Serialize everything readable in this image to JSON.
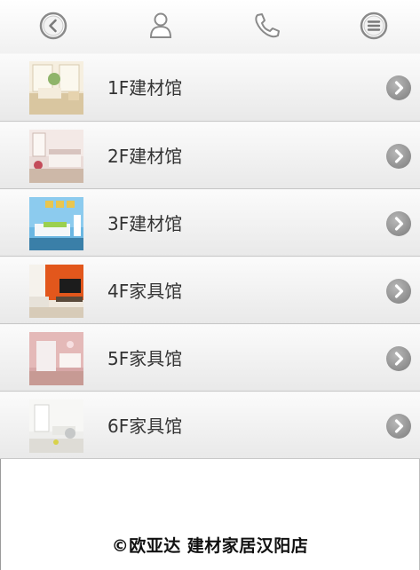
{
  "topbar": {
    "icons": [
      "back-icon",
      "user-icon",
      "phone-icon",
      "menu-icon"
    ]
  },
  "list": {
    "items": [
      {
        "label": "1F建材馆",
        "thumb": "room-photo-1"
      },
      {
        "label": "2F建材馆",
        "thumb": "room-photo-2"
      },
      {
        "label": "3F建材馆",
        "thumb": "room-photo-3"
      },
      {
        "label": "4F家具馆",
        "thumb": "room-photo-4"
      },
      {
        "label": "5F家具馆",
        "thumb": "room-photo-5"
      },
      {
        "label": "6F家具馆",
        "thumb": "room-photo-6"
      }
    ]
  },
  "footer": {
    "copyright": "©欧亚达 建材家居汉阳店"
  },
  "colors": {
    "chevron": "#8e8e8e",
    "text": "#333333"
  }
}
